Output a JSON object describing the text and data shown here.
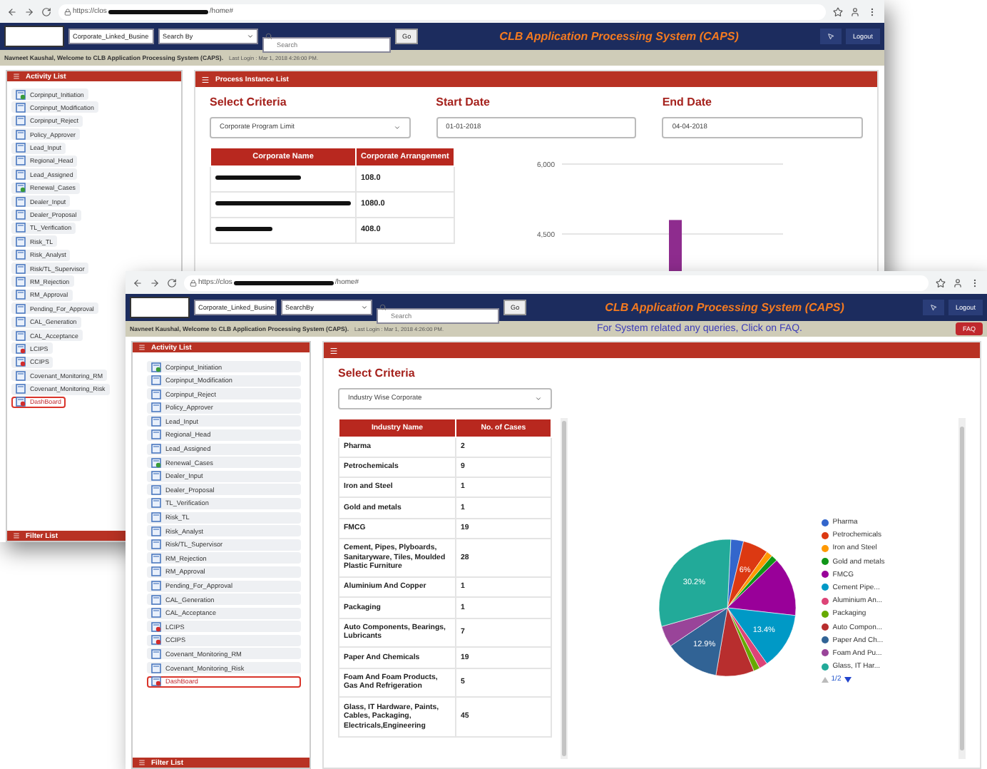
{
  "back_window": {
    "browser": {
      "url_start": "https://clos",
      "url_end": "/home#"
    },
    "header": {
      "business_select": "Corporate_Linked_Busine",
      "search_by_select": "Search By",
      "search_placeholder": "Search",
      "go_button": "Go",
      "title": "CLB Application Processing System (CAPS)",
      "logout": "Logout"
    },
    "welcome": {
      "message": "Navneet Kaushal, Welcome to CLB Application Processing System (CAPS).",
      "last_login": "Last Login : Mar 1, 2018 4:26:00 PM."
    },
    "sidebar": {
      "title": "Activity List",
      "footer_title": "Filter List",
      "items": [
        {
          "label": "Corpinput_Initiation",
          "kind": "plus",
          "selected": false
        },
        {
          "label": "Corpinput_Modification",
          "kind": "doc",
          "selected": false
        },
        {
          "label": "Corpinput_Reject",
          "kind": "doc",
          "selected": false
        },
        {
          "label": "Policy_Approver",
          "kind": "doc",
          "selected": false
        },
        {
          "label": "Lead_Input",
          "kind": "doc",
          "selected": false
        },
        {
          "label": "Regional_Head",
          "kind": "doc",
          "selected": false
        },
        {
          "label": "Lead_Assigned",
          "kind": "doc",
          "selected": false
        },
        {
          "label": "Renewal_Cases",
          "kind": "plus",
          "selected": false
        },
        {
          "label": "Dealer_Input",
          "kind": "doc",
          "selected": false
        },
        {
          "label": "Dealer_Proposal",
          "kind": "doc",
          "selected": false
        },
        {
          "label": "TL_Verification",
          "kind": "doc",
          "selected": false
        },
        {
          "label": "Risk_TL",
          "kind": "doc",
          "selected": false
        },
        {
          "label": "Risk_Analyst",
          "kind": "doc",
          "selected": false
        },
        {
          "label": "Risk/TL_Supervisor",
          "kind": "doc",
          "selected": false
        },
        {
          "label": "RM_Rejection",
          "kind": "doc",
          "selected": false
        },
        {
          "label": "RM_Approval",
          "kind": "doc",
          "selected": false
        },
        {
          "label": "Pending_For_Approval",
          "kind": "doc",
          "selected": false
        },
        {
          "label": "CAL_Generation",
          "kind": "doc",
          "selected": false
        },
        {
          "label": "CAL_Acceptance",
          "kind": "doc",
          "selected": false
        },
        {
          "label": "LCIPS",
          "kind": "alert",
          "selected": false
        },
        {
          "label": "CCIPS",
          "kind": "alert",
          "selected": false
        },
        {
          "label": "Covenant_Monitoring_RM",
          "kind": "doc",
          "selected": false
        },
        {
          "label": "Covenant_Monitoring_Risk",
          "kind": "doc",
          "selected": false
        },
        {
          "label": "DashBoard",
          "kind": "alert",
          "selected": true
        }
      ]
    },
    "panel": {
      "title": "Process Instance List",
      "criteria_label": "Select Criteria",
      "criteria_value": "Corporate Program Limit",
      "start_label": "Start Date",
      "start_value": "01-01-2018",
      "end_label": "End Date",
      "end_value": "04-04-2018",
      "table": {
        "columns": [
          "Corporate Name",
          "Corporate Arrangement"
        ],
        "rows": [
          {
            "value": "108.0"
          },
          {
            "value": "1080.0"
          },
          {
            "value": "408.0"
          }
        ]
      },
      "chart_data": {
        "type": "bar",
        "ylim": [
          3000,
          6000
        ],
        "yticks": [
          {
            "value": 4500,
            "label": "4,500"
          },
          {
            "value": 6000,
            "label": "6,000"
          }
        ],
        "series": [
          {
            "color": "#8e2c8e",
            "values": [
              4800
            ]
          }
        ]
      }
    }
  },
  "front_window": {
    "browser": {
      "url_start": "https://clos",
      "url_end": "/home#"
    },
    "header": {
      "business_select": "Corporate_Linked_Busine",
      "search_by_select": "SearchBy",
      "search_placeholder": "Search",
      "go_button": "Go",
      "title": "CLB Application Processing System (CAPS)",
      "logout": "Logout"
    },
    "welcome": {
      "message": "Navneet Kaushal, Welcome to CLB Application Processing System (CAPS).",
      "last_login": "Last Login : Mar 1, 2018 4:26:00 PM.",
      "faq_notice": "For System related any queries, Click on FAQ.",
      "faq_button": "FAQ"
    },
    "sidebar": {
      "title": "Activity List",
      "footer_title": "Filter List",
      "items": [
        {
          "label": "Corpinput_Initiation",
          "kind": "plus",
          "selected": false
        },
        {
          "label": "Corpinput_Modification",
          "kind": "doc",
          "selected": false
        },
        {
          "label": "Corpinput_Reject",
          "kind": "doc",
          "selected": false
        },
        {
          "label": "Policy_Approver",
          "kind": "doc",
          "selected": false
        },
        {
          "label": "Lead_Input",
          "kind": "doc",
          "selected": false
        },
        {
          "label": "Regional_Head",
          "kind": "doc",
          "selected": false
        },
        {
          "label": "Lead_Assigned",
          "kind": "doc",
          "selected": false
        },
        {
          "label": "Renewal_Cases",
          "kind": "plus",
          "selected": false
        },
        {
          "label": "Dealer_Input",
          "kind": "doc",
          "selected": false
        },
        {
          "label": "Dealer_Proposal",
          "kind": "doc",
          "selected": false
        },
        {
          "label": "TL_Verification",
          "kind": "doc",
          "selected": false
        },
        {
          "label": "Risk_TL",
          "kind": "doc",
          "selected": false
        },
        {
          "label": "Risk_Analyst",
          "kind": "doc",
          "selected": false
        },
        {
          "label": "Risk/TL_Supervisor",
          "kind": "doc",
          "selected": false
        },
        {
          "label": "RM_Rejection",
          "kind": "doc",
          "selected": false
        },
        {
          "label": "RM_Approval",
          "kind": "doc",
          "selected": false
        },
        {
          "label": "Pending_For_Approval",
          "kind": "doc",
          "selected": false
        },
        {
          "label": "CAL_Generation",
          "kind": "doc",
          "selected": false
        },
        {
          "label": "CAL_Acceptance",
          "kind": "doc",
          "selected": false
        },
        {
          "label": "LCIPS",
          "kind": "alert",
          "selected": false
        },
        {
          "label": "CCIPS",
          "kind": "alert",
          "selected": false
        },
        {
          "label": "Covenant_Monitoring_RM",
          "kind": "doc",
          "selected": false
        },
        {
          "label": "Covenant_Monitoring_Risk",
          "kind": "doc",
          "selected": false
        },
        {
          "label": "DashBoard",
          "kind": "alert",
          "selected": true
        }
      ]
    },
    "panel": {
      "criteria_label": "Select Criteria",
      "criteria_value": "Industry Wise Corporate",
      "table": {
        "columns": [
          "Industry Name",
          "No. of Cases"
        ],
        "rows": [
          {
            "industry": "Pharma",
            "cases": "2"
          },
          {
            "industry": "Petrochemicals",
            "cases": "9"
          },
          {
            "industry": "Iron and Steel",
            "cases": "1"
          },
          {
            "industry": "Gold and metals",
            "cases": "1"
          },
          {
            "industry": "FMCG",
            "cases": "19"
          },
          {
            "industry": "Cement, Pipes, Plyboards, Sanitaryware, Tiles, Moulded Plastic Furniture",
            "cases": "28"
          },
          {
            "industry": "Aluminium And Copper",
            "cases": "1"
          },
          {
            "industry": "Packaging",
            "cases": "1"
          },
          {
            "industry": "Auto Components, Bearings, Lubricants",
            "cases": "7"
          },
          {
            "industry": "Paper And Chemicals",
            "cases": "19"
          },
          {
            "industry": "Foam And Foam Products, Gas And Refrigeration",
            "cases": "5"
          },
          {
            "industry": "Glass, IT Hardware, Paints, Cables, Packaging, Electricals,Engineering",
            "cases": "45"
          }
        ]
      },
      "chart_data": {
        "type": "pie",
        "categories": [
          "Pharma",
          "Petrochemicals",
          "Iron and Steel",
          "Gold and metals",
          "FMCG",
          "Cement Pipe...",
          "Aluminium An...",
          "Packaging",
          "Auto Compon...",
          "Paper And Ch...",
          "Foam And Pu...",
          "Glass, IT Har..."
        ],
        "values": [
          3,
          6,
          1.5,
          1.5,
          14,
          13.4,
          2,
          1.5,
          9,
          12.9,
          5,
          30.2
        ],
        "colors": [
          "#3366cc",
          "#dc3912",
          "#ff9900",
          "#109618",
          "#990099",
          "#0099c6",
          "#dd4477",
          "#66aa00",
          "#b82e2e",
          "#316395",
          "#994499",
          "#22aa99"
        ],
        "value_labels": [
          null,
          "6%",
          null,
          null,
          null,
          "13.4%",
          null,
          null,
          null,
          "12.9%",
          null,
          "30.2%"
        ]
      },
      "legend_page": "1/2"
    }
  }
}
